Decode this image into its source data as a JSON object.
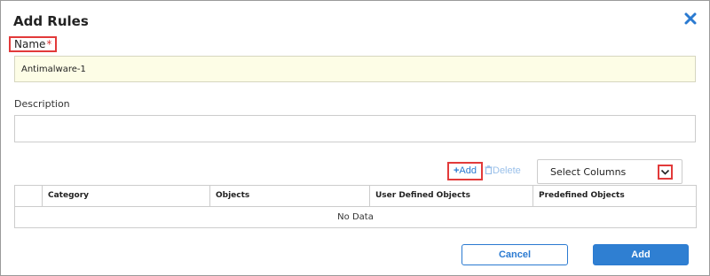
{
  "dialog": {
    "title": "Add Rules",
    "close_icon": "close-icon",
    "accent_color": "#2a7ad1"
  },
  "form": {
    "name_label": "Name",
    "name_required_marker": "*",
    "name_value": "Antimalware-1",
    "description_label": "Description",
    "description_value": ""
  },
  "toolbar": {
    "add_label": "Add",
    "add_icon": "plus-icon",
    "delete_label": "Delete",
    "delete_icon": "trash-icon",
    "select_columns_label": "Select Columns",
    "select_columns_icon": "chevron-down-icon"
  },
  "table": {
    "columns": [
      "",
      "Category",
      "Objects",
      "User Defined Objects",
      "Predefined Objects"
    ],
    "empty_text": "No Data"
  },
  "footer": {
    "cancel_label": "Cancel",
    "add_label": "Add"
  }
}
